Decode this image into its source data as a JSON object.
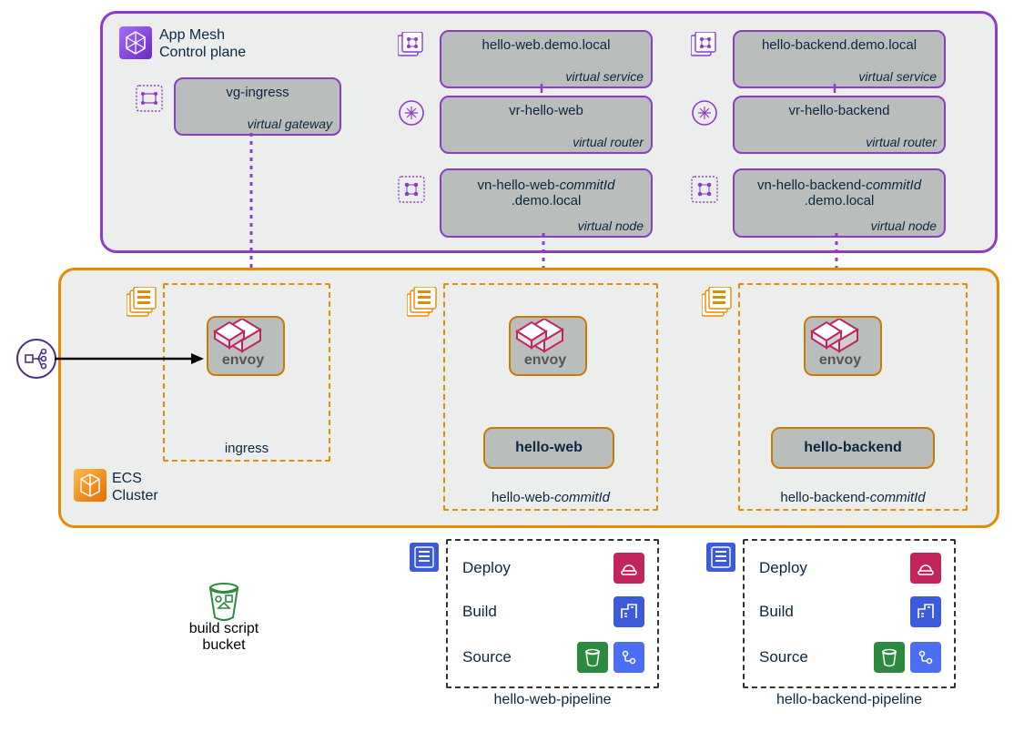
{
  "appmesh": {
    "title_line1": "App Mesh",
    "title_line2": "Control plane",
    "vg": {
      "name": "vg-ingress",
      "type": "virtual gateway"
    },
    "web": {
      "vs": {
        "name": "hello-web.demo.local",
        "type": "virtual service"
      },
      "vr": {
        "name": "vr-hello-web",
        "type": "virtual router"
      },
      "vn": {
        "name_prefix": "vn-hello-web-",
        "commit": "commitId",
        "suffix": ".demo.local",
        "type": "virtual node"
      }
    },
    "backend": {
      "vs": {
        "name": "hello-backend.demo.local",
        "type": "virtual service"
      },
      "vr": {
        "name": "vr-hello-backend",
        "type": "virtual router"
      },
      "vn": {
        "name_prefix": "vn-hello-backend-",
        "commit": "commitId",
        "suffix": ".demo.local",
        "type": "virtual node"
      }
    }
  },
  "ecs": {
    "title_line1": "ECS",
    "title_line2": "Cluster",
    "ingress_label": "ingress",
    "web_label_prefix": "hello-web-",
    "web_label_commit": "commitId",
    "backend_label_prefix": "hello-backend-",
    "backend_label_commit": "commitId",
    "envoy_label": "envoy",
    "web_service": "hello-web",
    "backend_service": "hello-backend"
  },
  "bucket_label_line1": "build script",
  "bucket_label_line2": "bucket",
  "pipeline": {
    "stages": {
      "deploy": "Deploy",
      "build": "Build",
      "source": "Source"
    },
    "web_name": "hello-web-pipeline",
    "backend_name": "hello-backend-pipeline"
  },
  "icons": {
    "appmesh": "app-mesh-icon",
    "ecs": "ecs-icon",
    "task_stack": "task-definition-stack-icon",
    "graph": "mesh-resource-icon",
    "bucket": "s3-bucket-icon",
    "elb": "elastic-load-balancer-icon",
    "codepipeline": "codepipeline-icon",
    "codedeploy": "codedeploy-icon",
    "codebuild": "codebuild-icon",
    "codecommit": "codecommit-icon",
    "envoy": "envoy-icon"
  }
}
